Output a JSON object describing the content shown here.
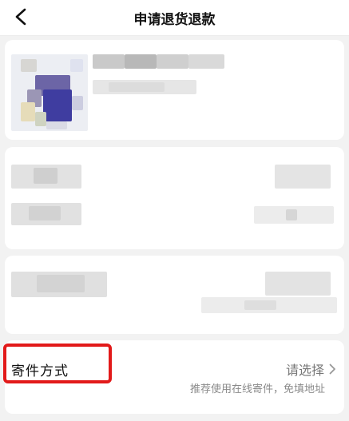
{
  "header": {
    "title": "申请退货退款",
    "back_icon": "back-arrow-icon"
  },
  "shipping": {
    "label": "寄件方式",
    "select_text": "请选择",
    "select_icon": "chevron-right-icon",
    "hint": "推荐使用在线寄件，免填地址"
  },
  "highlight_color": "#e21a1a"
}
